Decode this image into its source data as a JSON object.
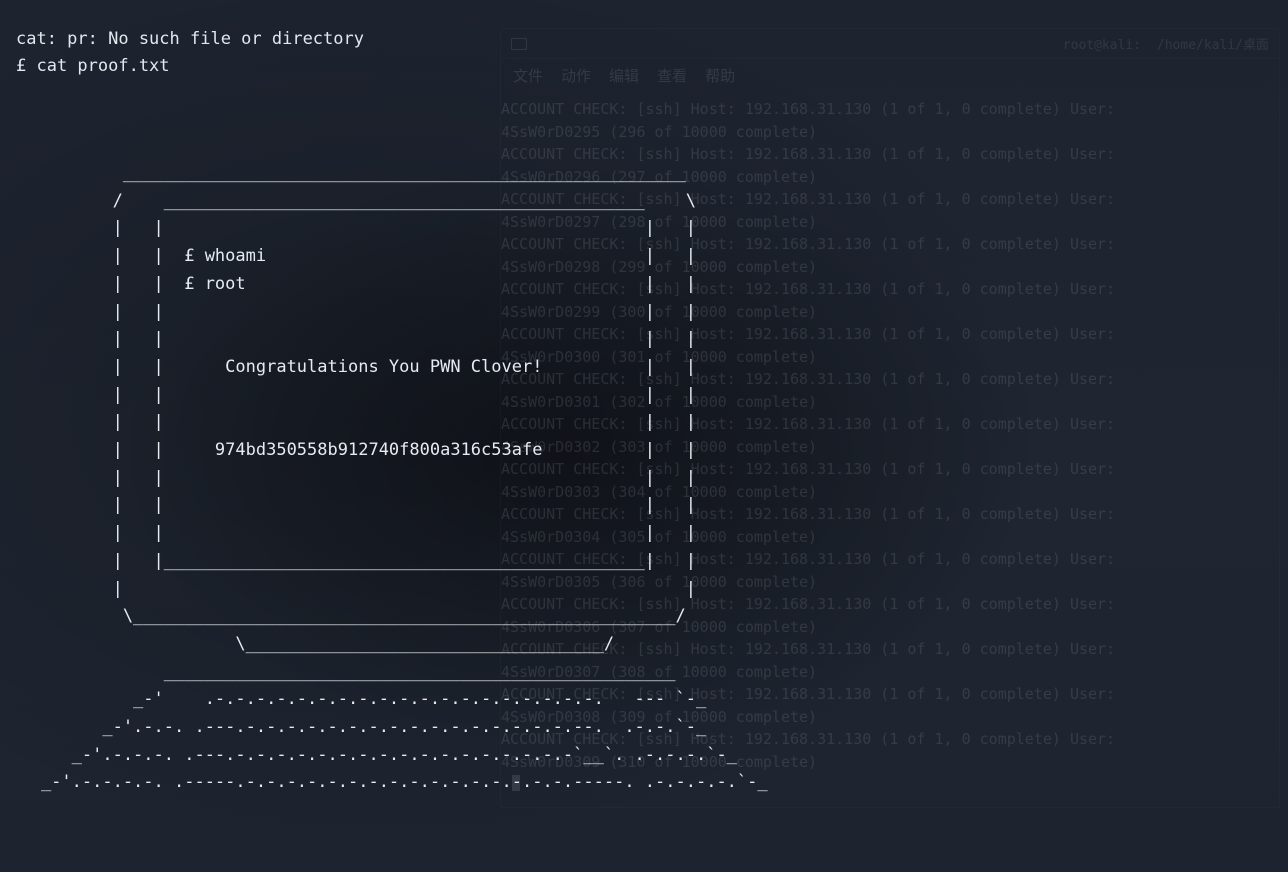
{
  "fg_terminal": {
    "line_err": "cat: pr: No such file or directory",
    "line_cmd": "£ cat proof.txt",
    "ascii": {
      "l00": "            _______________________________________________________",
      "l01": "           /    _______________________________________________    \\",
      "l02": "           |   |                                               |   |",
      "l03": "           |   |  £ whoami                                     |   |",
      "l04": "           |   |  £ root                                       |   |",
      "l05": "           |   |                                               |   |",
      "l06": "           |   |                                               |   |",
      "l07": "           |   |      Congratulations You PWN Clover!          |   |",
      "l08": "           |   |                                               |   |",
      "l09": "           |   |                                               |   |",
      "l10": "           |   |     974bd350558b912740f800a316c53afe          |   |",
      "l11": "           |   |                                               |   |",
      "l12": "           |   |                                               |   |",
      "l13": "           |   |                                               |   |",
      "l14": "           |   |_______________________________________________|   |",
      "l15": "           |                                                       |",
      "l16": "            \\_____________________________________________________/",
      "l17": "                       \\___________________________________/",
      "l18": "                __________________________________________________",
      "l19": "             _-'    .-.-.-.-.-.-.-.-.-.-.-.-.-.-.-.-.-.-.-.   --- `-_",
      "l20": "          _-'.-.-. .---.-.-.-.-.-.-.-.-.-.-.-.-.-.-.-.-.--.  .-.-.`-_",
      "l21": "       _-'.-.-.-. .---.-.-.-.-.-.-.-.-.-.-.-.-.-.-.-.-.-`__`. .-.-.-.`-_",
      "l22": "    _-'.-.-.-.-. .-----.-.-.-.-.-.-.-.-.-.-.-.-.-.-.-.-.-----. .-.-.-.-.`-_"
    }
  },
  "bg_window": {
    "title_user": "root@kali:",
    "title_path": " /home/kali/桌面",
    "menu": {
      "file": "文件",
      "actions": "动作",
      "edit": "编辑",
      "view": "查看",
      "help": "帮助"
    },
    "log": {
      "host_prefix": "ACCOUNT CHECK: [ssh] Host: 192.168.31.130 (1 of 1, 0 complete) User:",
      "pw_base": "4SsW0rD0",
      "total": "10000",
      "entries": [
        {
          "idx": "295",
          "count": "296"
        },
        {
          "idx": "296",
          "count": "297"
        },
        {
          "idx": "297",
          "count": "298"
        },
        {
          "idx": "298",
          "count": "299"
        },
        {
          "idx": "299",
          "count": "300"
        },
        {
          "idx": "300",
          "count": "301"
        },
        {
          "idx": "301",
          "count": "302"
        },
        {
          "idx": "302",
          "count": "303"
        },
        {
          "idx": "303",
          "count": "304"
        },
        {
          "idx": "304",
          "count": "305"
        },
        {
          "idx": "305",
          "count": "306"
        },
        {
          "idx": "306",
          "count": "307"
        },
        {
          "idx": "307",
          "count": "308"
        },
        {
          "idx": "308",
          "count": "309"
        },
        {
          "idx": "309",
          "count": "310"
        }
      ]
    }
  }
}
